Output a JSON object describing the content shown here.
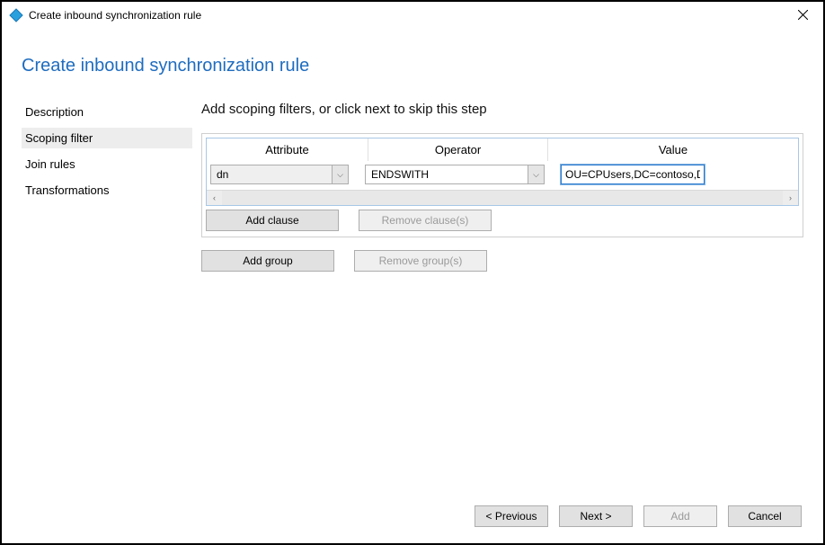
{
  "window": {
    "title": "Create inbound synchronization rule"
  },
  "page": {
    "heading": "Create inbound synchronization rule",
    "step_heading": "Add scoping filters, or click next to skip this step"
  },
  "sidebar": {
    "items": [
      {
        "label": "Description",
        "active": false
      },
      {
        "label": "Scoping filter",
        "active": true
      },
      {
        "label": "Join rules",
        "active": false
      },
      {
        "label": "Transformations",
        "active": false
      }
    ]
  },
  "grid": {
    "header_attribute": "Attribute",
    "header_operator": "Operator",
    "header_value": "Value",
    "row": {
      "attribute": "dn",
      "operator": "ENDSWITH",
      "value": "OU=CPUsers,DC=contoso,DC=com"
    }
  },
  "buttons": {
    "add_clause": "Add clause",
    "remove_clause": "Remove clause(s)",
    "add_group": "Add group",
    "remove_group": "Remove group(s)",
    "previous": "< Previous",
    "next": "Next >",
    "add": "Add",
    "cancel": "Cancel"
  }
}
